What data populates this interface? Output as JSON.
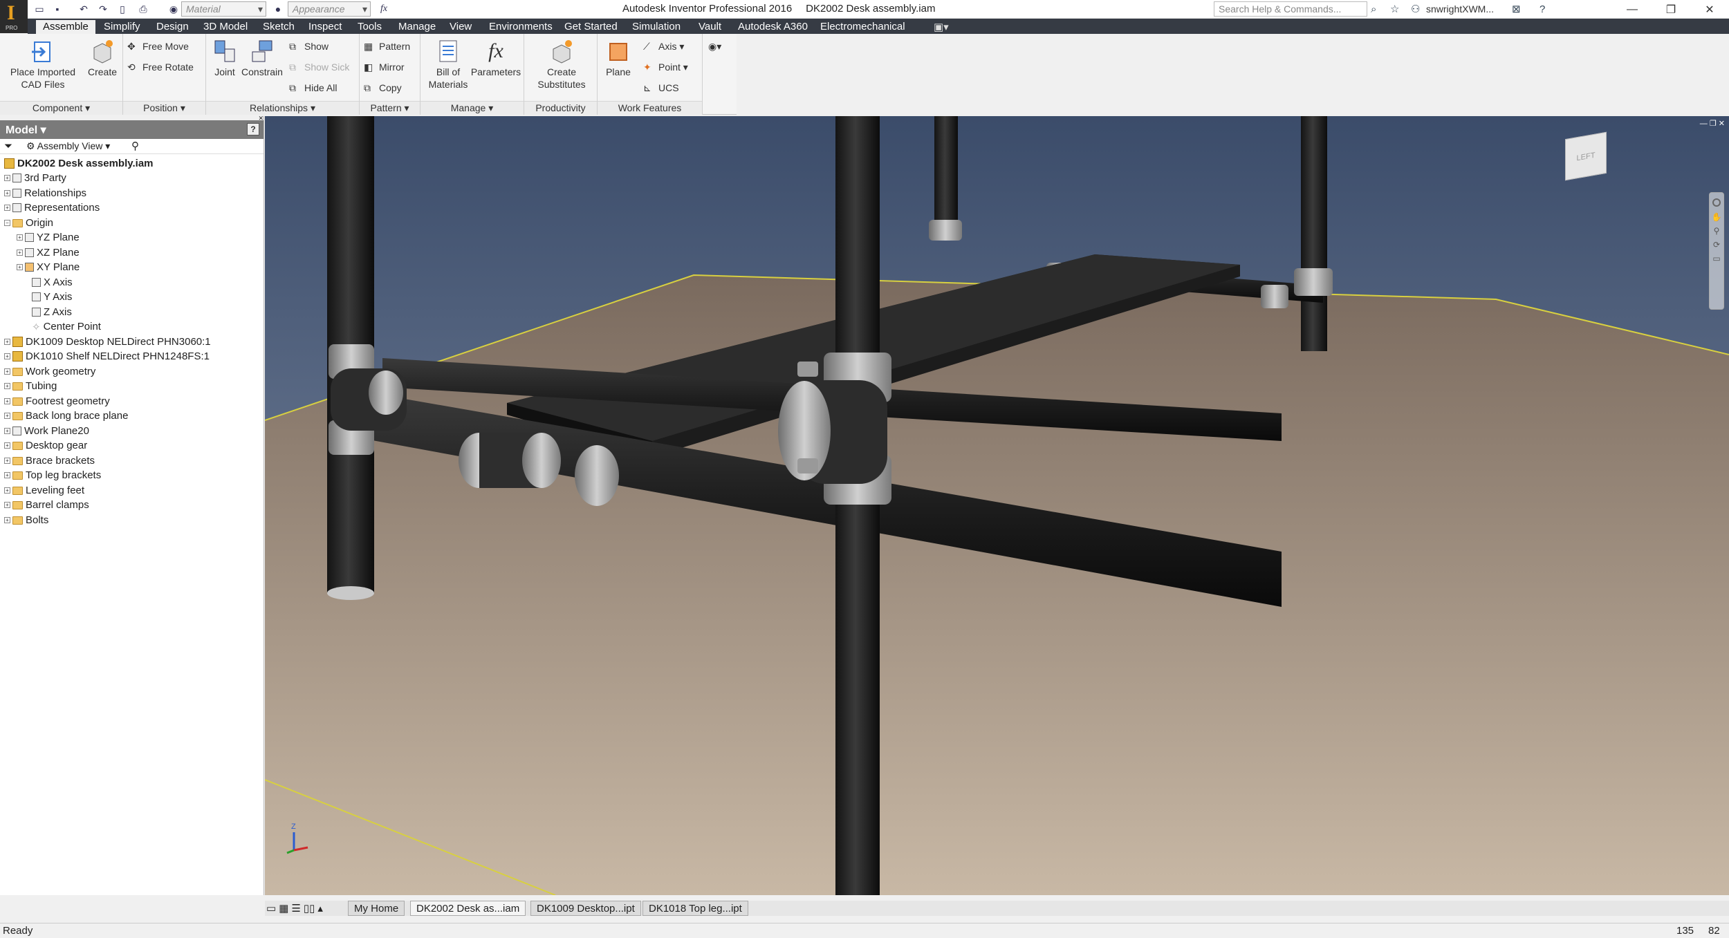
{
  "titlebar": {
    "app": "Autodesk Inventor Professional 2016",
    "document": "DK2002 Desk assembly.iam",
    "material": "Material",
    "appearance": "Appearance",
    "fx": "fx",
    "search_placeholder": "Search Help & Commands...",
    "user": "snwrightXWM..."
  },
  "tabs": [
    "Assemble",
    "Simplify",
    "Design",
    "3D Model",
    "Sketch",
    "Inspect",
    "Tools",
    "Manage",
    "View",
    "Environments",
    "Get Started",
    "Simulation",
    "Vault",
    "Autodesk A360",
    "Electromechanical"
  ],
  "ribbon": {
    "component": {
      "label": "Component",
      "place_line1": "Place Imported",
      "place_line2": "CAD Files",
      "create": "Create"
    },
    "position": {
      "label": "Position",
      "free_move": "Free Move",
      "free_rotate": "Free Rotate"
    },
    "relationships": {
      "label": "Relationships",
      "joint": "Joint",
      "constrain": "Constrain",
      "show": "Show",
      "show_sick": "Show Sick",
      "hide_all": "Hide All"
    },
    "pattern": {
      "label": "Pattern",
      "pattern": "Pattern",
      "mirror": "Mirror",
      "copy": "Copy"
    },
    "manage": {
      "label": "Manage",
      "bom_line1": "Bill of",
      "bom_line2": "Materials",
      "parameters": "Parameters"
    },
    "productivity": {
      "label": "Productivity",
      "cs_line1": "Create",
      "cs_line2": "Substitutes"
    },
    "work_features": {
      "label": "Work Features",
      "plane": "Plane",
      "axis": "Axis",
      "point": "Point",
      "ucs": "UCS"
    }
  },
  "browser": {
    "title": "Model",
    "view": "Assembly View",
    "root": "DK2002 Desk assembly.iam",
    "items": [
      "3rd Party",
      "Relationships",
      "Representations",
      "Origin",
      "YZ Plane",
      "XZ Plane",
      "XY Plane",
      "X Axis",
      "Y Axis",
      "Z Axis",
      "Center Point",
      "DK1009 Desktop NELDirect PHN3060:1",
      "DK1010 Shelf NELDirect PHN1248FS:1",
      "Work geometry",
      "Tubing",
      "Footrest geometry",
      "Back long brace plane",
      "Work Plane20",
      "Desktop gear",
      "Brace brackets",
      "Top leg brackets",
      "Leveling feet",
      "Barrel clamps",
      "Bolts"
    ]
  },
  "viewcube": {
    "face": "LEFT"
  },
  "triad": {
    "z": "Z"
  },
  "doc_tabs": [
    "My Home",
    "DK2002 Desk as...iam",
    "DK1009 Desktop...ipt",
    "DK1018 Top leg...ipt"
  ],
  "status": {
    "text": "Ready",
    "n1": "135",
    "n2": "82"
  }
}
